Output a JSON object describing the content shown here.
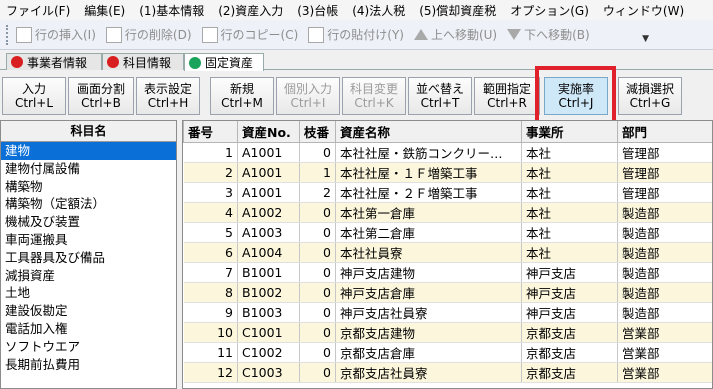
{
  "menu": [
    "ファイル(F)",
    "編集(E)",
    "(1)基本情報",
    "(2)資産入力",
    "(3)台帳",
    "(4)法人税",
    "(5)償却資産税",
    "オプション(G)",
    "ウィンドウ(W)"
  ],
  "toolbar": {
    "items": [
      {
        "label": "行の挿入(I)",
        "icon": "doc-insert-icon"
      },
      {
        "label": "行の削除(D)",
        "icon": "doc-delete-icon"
      },
      {
        "label": "行のコピー(C)",
        "icon": "doc-copy-icon"
      },
      {
        "label": "行の貼付け(Y)",
        "icon": "doc-paste-icon"
      },
      {
        "label": "上へ移動(U)",
        "icon": "arrow-up-icon"
      },
      {
        "label": "下へ移動(B)",
        "icon": "arrow-down-icon"
      }
    ]
  },
  "tabs": [
    {
      "label": "事業者情報",
      "dot_color": "#d81e1e"
    },
    {
      "label": "科目情報",
      "dot_color": "#d81e1e"
    },
    {
      "label": "固定資産",
      "dot_color": "#1aa35a"
    }
  ],
  "buttons": [
    {
      "line1": "入力",
      "line2": "Ctrl+L"
    },
    {
      "line1": "画面分割",
      "line2": "Ctrl+B"
    },
    {
      "line1": "表示設定",
      "line2": "Ctrl+H"
    },
    {
      "line1": "新規",
      "line2": "Ctrl+M"
    },
    {
      "line1": "個別入力",
      "line2": "Ctrl+I"
    },
    {
      "line1": "科目変更",
      "line2": "Ctrl+K"
    },
    {
      "line1": "並べ替え",
      "line2": "Ctrl+T"
    },
    {
      "line1": "範囲指定",
      "line2": "Ctrl+R"
    },
    {
      "line1": "実施率",
      "line2": "Ctrl+J"
    },
    {
      "line1": "減損選択",
      "line2": "Ctrl+G"
    }
  ],
  "subjects": {
    "header": "科目名",
    "items": [
      "建物",
      "建物付属設備",
      "構築物",
      "構築物（定額法）",
      "機械及び装置",
      "車両運搬具",
      "工具器具及び備品",
      "減損資産",
      "土地",
      "建設仮勘定",
      "電話加入権",
      "ソフトウエア",
      "長期前払費用"
    ]
  },
  "table": {
    "headers": [
      "番号",
      "資産No.",
      "枝番",
      "資産名称",
      "事業所",
      "部門"
    ],
    "rows": [
      [
        "1",
        "A1001",
        "0",
        "本社社屋・鉄筋コンクリー…",
        "本社",
        "管理部"
      ],
      [
        "2",
        "A1001",
        "1",
        "本社社屋・１Ｆ増築工事",
        "本社",
        "管理部"
      ],
      [
        "3",
        "A1001",
        "2",
        "本社社屋・２Ｆ増築工事",
        "本社",
        "管理部"
      ],
      [
        "4",
        "A1002",
        "0",
        "本社第一倉庫",
        "本社",
        "製造部"
      ],
      [
        "5",
        "A1003",
        "0",
        "本社第二倉庫",
        "本社",
        "製造部"
      ],
      [
        "6",
        "A1004",
        "0",
        "本社社員寮",
        "本社",
        "製造部"
      ],
      [
        "7",
        "B1001",
        "0",
        "神戸支店建物",
        "神戸支店",
        "製造部"
      ],
      [
        "8",
        "B1002",
        "0",
        "神戸支店倉庫",
        "神戸支店",
        "製造部"
      ],
      [
        "9",
        "B1003",
        "0",
        "神戸支店社員寮",
        "神戸支店",
        "製造部"
      ],
      [
        "10",
        "C1001",
        "0",
        "京都支店建物",
        "京都支店",
        "営業部"
      ],
      [
        "11",
        "C1002",
        "0",
        "京都支店倉庫",
        "京都支店",
        "営業部"
      ],
      [
        "12",
        "C1003",
        "0",
        "京都支店社員寮",
        "京都支店",
        "営業部"
      ]
    ]
  }
}
